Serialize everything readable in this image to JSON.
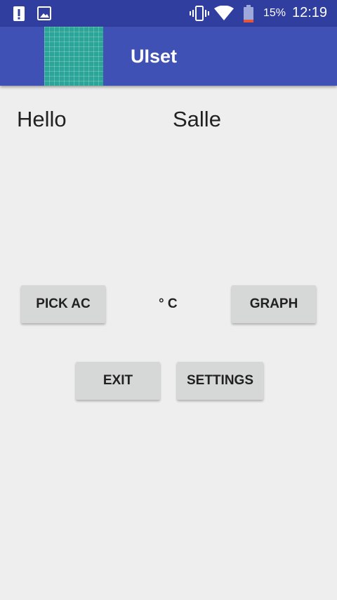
{
  "status_bar": {
    "battery_percent": "15%",
    "time": "12:19",
    "background_color": "#303f9f",
    "icons": [
      "alert-icon",
      "image-icon",
      "vibrate-icon",
      "wifi-icon",
      "battery-icon"
    ]
  },
  "app_bar": {
    "title": "UIset",
    "background_color": "#3f51b5",
    "logo_color": "#2aa597"
  },
  "main": {
    "greeting": "Hello",
    "room_label": "Salle",
    "temperature_unit": "° C",
    "buttons": {
      "pick_ac": "PICK AC",
      "graph": "GRAPH",
      "exit": "EXIT",
      "settings": "SETTINGS"
    }
  }
}
